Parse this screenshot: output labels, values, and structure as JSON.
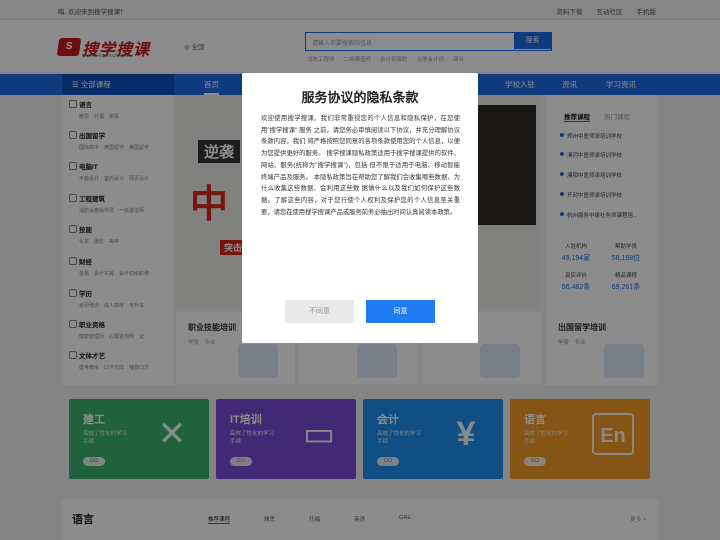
{
  "topbar": {
    "welcome": "嗨, 欢迎来到搜学搜课！",
    "links": [
      "资料下载",
      "互动社区",
      "手机版"
    ]
  },
  "logo": {
    "mark": "S",
    "name": "搜学搜课",
    "url": "WWW.SOXSOK.COM"
  },
  "location": {
    "icon": "location-pin-icon",
    "label": "全国"
  },
  "search": {
    "placeholder": "请输入你要搜索的信息",
    "button": "搜索",
    "hotwords": [
      "消防工程师",
      "二级建造师",
      "会计初级职",
      "注册会计师",
      "商业"
    ]
  },
  "nav": {
    "all": "全部课程",
    "items": [
      "首页",
      "学校入驻",
      "资讯",
      "学习资讯"
    ]
  },
  "sidebar": [
    {
      "title": "语言",
      "icon": "mic-icon",
      "subs": "雅思　托福　英语"
    },
    {
      "title": "出国留学",
      "icon": "book-icon",
      "subs": "国际高中　英国留学　美国留学"
    },
    {
      "title": "电脑IT",
      "icon": "computer-icon",
      "subs": "平面设计　室内设计　网页设计"
    },
    {
      "title": "工程建筑",
      "icon": "building-icon",
      "subs": "消防设施操作员　一级建造师"
    },
    {
      "title": "技能",
      "icon": "tool-icon",
      "subs": "化妆　摄影　美甲"
    },
    {
      "title": "财经",
      "icon": "money-icon",
      "subs": "金融　会计实操　会计初级职称"
    },
    {
      "title": "学历",
      "icon": "graduate-icon",
      "subs": "考研培训　成人高考　专升本"
    },
    {
      "title": "职业资格",
      "icon": "certificate-icon",
      "subs": "健康管理师　心理咨询师　证"
    },
    {
      "title": "文体才艺",
      "icon": "music-icon",
      "subs": "健身教练　口才交际　播音口才"
    }
  ],
  "banner": {
    "sub": "逆袭",
    "big": "中",
    "tag": "突击"
  },
  "right_panel": {
    "tabs": [
      "推荐课程",
      "热门课程"
    ],
    "list": [
      "郑州中医师承培训学校",
      "漯河中医师承培训学校",
      "濮阳中医师承培训学校",
      "开封中医师承培训学校",
      "杭州服务中级社务师课程培..."
    ],
    "stats": [
      {
        "label": "入驻机构",
        "value": "49,194家"
      },
      {
        "label": "帮助学员",
        "value": "58,168位"
      },
      {
        "label": "真实评价",
        "value": "56,482条"
      },
      {
        "label": "精品课程",
        "value": "69,261条"
      }
    ]
  },
  "cards": [
    {
      "title": "职业技能培训",
      "sub": "学费　专业"
    },
    {
      "title": "",
      "sub": ""
    },
    {
      "title": "",
      "sub": ""
    },
    {
      "title": "出国留学培训",
      "sub": "学费　专业"
    }
  ],
  "tiles": [
    {
      "title": "建工",
      "desc": "高效了性化的学习手续",
      "go": "GO",
      "icon": "tools-icon",
      "color": "#3bb36e"
    },
    {
      "title": "IT培训",
      "desc": "高效了性化的学习手续",
      "go": "GO",
      "icon": "laptop-icon",
      "color": "#7a4ad6"
    },
    {
      "title": "会计",
      "desc": "高效了性化的学习手续",
      "go": "GO",
      "icon": "accountant-icon",
      "color": "#1f8ff0"
    },
    {
      "title": "语言",
      "desc": "高效了性化的学习手续",
      "go": "GO",
      "icon": "english-icon",
      "color": "#f49a27"
    }
  ],
  "section": {
    "title": "语言",
    "tabs": [
      "推荐课程",
      "雅思",
      "托福",
      "英语",
      "GRE"
    ],
    "more": "更多 >"
  },
  "modal": {
    "title": "服务协议的隐私条款",
    "body": "欢迎使用搜学搜课。我们非常重视您的个人信息和隐私保护，在您使用\"搜学搜课\" 服务 之前，请您务必审慎阅读以下协议，并充分理解协议条款内容。我们 将严格按照您同意的各项条款使用您的个人信息，以便为您提供更好的服务。 搜学搜课隐私政策适用于搜学搜课提供的软件、网站、服务(统称为\"搜学搜课\")，包括 但不限于适用于电脑、移动智能终端产品及服务。 本隐私政策旨在帮助您了解我们会收集哪些数据、为什么收集这些数据、会利用这些数 据做什么以及我们如何保护这些数据。了解这些内容，对于您行使个人权利及保护您的个人信息至关重要，请您在使用搜学搜课产品或服务前务必抽出时间认真阅读本政策。",
    "decline": "不同意",
    "accept": "同意"
  }
}
